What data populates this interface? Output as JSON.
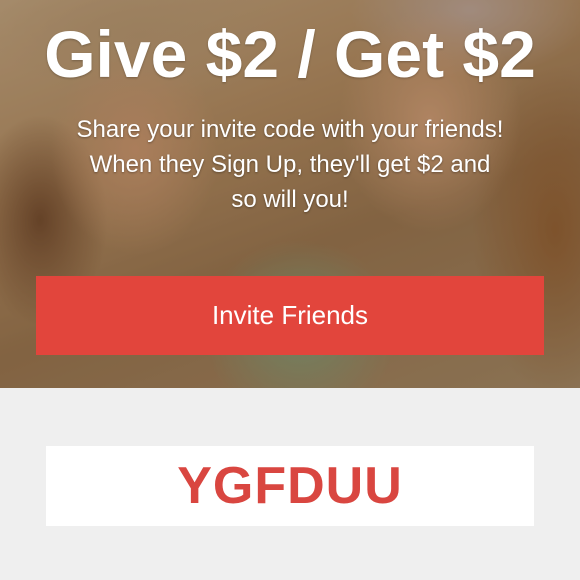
{
  "hero": {
    "headline": "Give $2 / Get $2",
    "subtext_line1": "Share your invite code with your friends!",
    "subtext_line2": "When they Sign Up, they'll get $2 and",
    "subtext_line3": "so will you!"
  },
  "invite_button": {
    "label": "Invite Friends"
  },
  "invite_code": {
    "value": "YGFDUU"
  },
  "colors": {
    "accent": "#e2453c",
    "code_text": "#d94640",
    "page_background": "#efefef",
    "code_box_background": "#ffffff",
    "hero_text": "#ffffff"
  }
}
